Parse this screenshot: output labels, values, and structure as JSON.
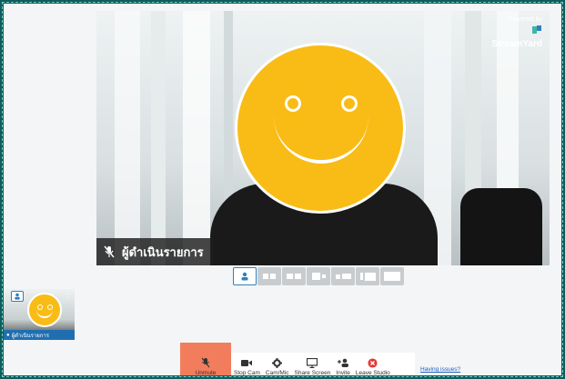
{
  "main_video": {
    "name_tag": "ผู้ดำเนินรายการ",
    "powered_by": "Powered by",
    "brand": "StreamYard"
  },
  "thumbnail": {
    "label": "ผู้ดำเนินรายการ"
  },
  "toolbar": {
    "unmute": "Unmute",
    "stop_cam": "Stop Cam",
    "cam_mic": "Cam/Mic",
    "share_screen": "Share Screen",
    "invite": "Invite",
    "leave_studio": "Leave Studio",
    "having_issues": "Having issues?"
  },
  "colors": {
    "unmute_highlight": "#f27d5c",
    "leave_icon": "#e53935",
    "accent": "#2f80c0",
    "face": "#f9bc16"
  },
  "icons": [
    "mic-off-icon",
    "camera-icon",
    "gear-icon",
    "monitor-icon",
    "add-person-icon",
    "close-circle-icon"
  ]
}
